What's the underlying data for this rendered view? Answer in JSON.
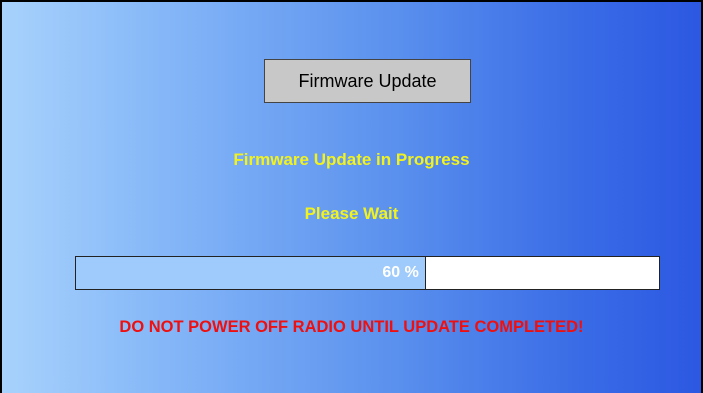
{
  "dialog": {
    "title_button_label": "Firmware Update",
    "status_text": "Firmware Update in Progress",
    "wait_text": "Please Wait",
    "warning_text": "DO NOT POWER OFF RADIO UNTIL UPDATE COMPLETED!"
  },
  "progress": {
    "value_percent": 60,
    "label": "60 %"
  },
  "colors": {
    "status_text": "#f2f21e",
    "warning_text": "#ee1010",
    "progress_fill": "#9ecbfb",
    "background_gradient_start": "#a8d2fc",
    "background_gradient_end": "#2c58e2"
  }
}
